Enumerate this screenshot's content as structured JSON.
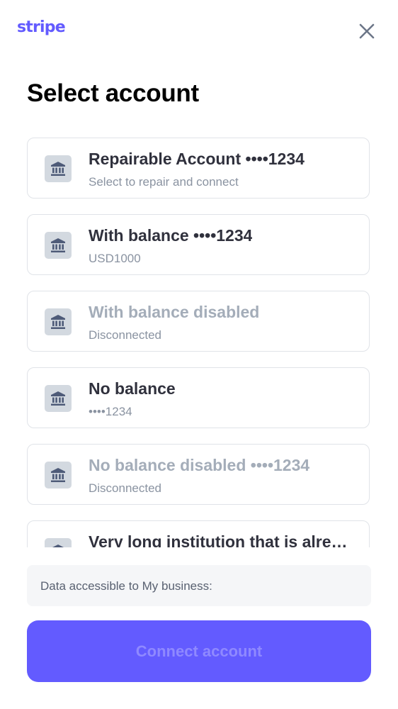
{
  "header": {
    "logo_text": "stripe",
    "close_icon": "close-icon"
  },
  "page_title": "Select account",
  "accounts": [
    {
      "name": "Repairable Account ••••1234",
      "subtitle": "Select to repair and connect",
      "disabled": false,
      "icon": "bank-icon"
    },
    {
      "name": "With balance ••••1234",
      "subtitle": "USD1000",
      "disabled": false,
      "icon": "bank-icon"
    },
    {
      "name": "With balance disabled",
      "subtitle": "Disconnected",
      "disabled": true,
      "icon": "bank-icon"
    },
    {
      "name": "No balance",
      "subtitle": "••••1234",
      "disabled": false,
      "icon": "bank-icon"
    },
    {
      "name": "No balance disabled ••••1234",
      "subtitle": "Disconnected",
      "disabled": true,
      "icon": "bank-icon"
    },
    {
      "name": "Very long institution that is already linked",
      "subtitle": "",
      "disabled": false,
      "icon": "bank-icon"
    }
  ],
  "data_notice": "Data accessible to My business:",
  "connect_button": "Connect account",
  "colors": {
    "brand": "#635bff",
    "button_text_disabled": "#8f89ff",
    "title": "#000000",
    "account_name": "#30313d",
    "account_name_disabled": "#a4adb9",
    "subtitle": "#8a93a1",
    "icon_bg": "#d3d9e0",
    "icon_fg": "#4e5b78"
  }
}
